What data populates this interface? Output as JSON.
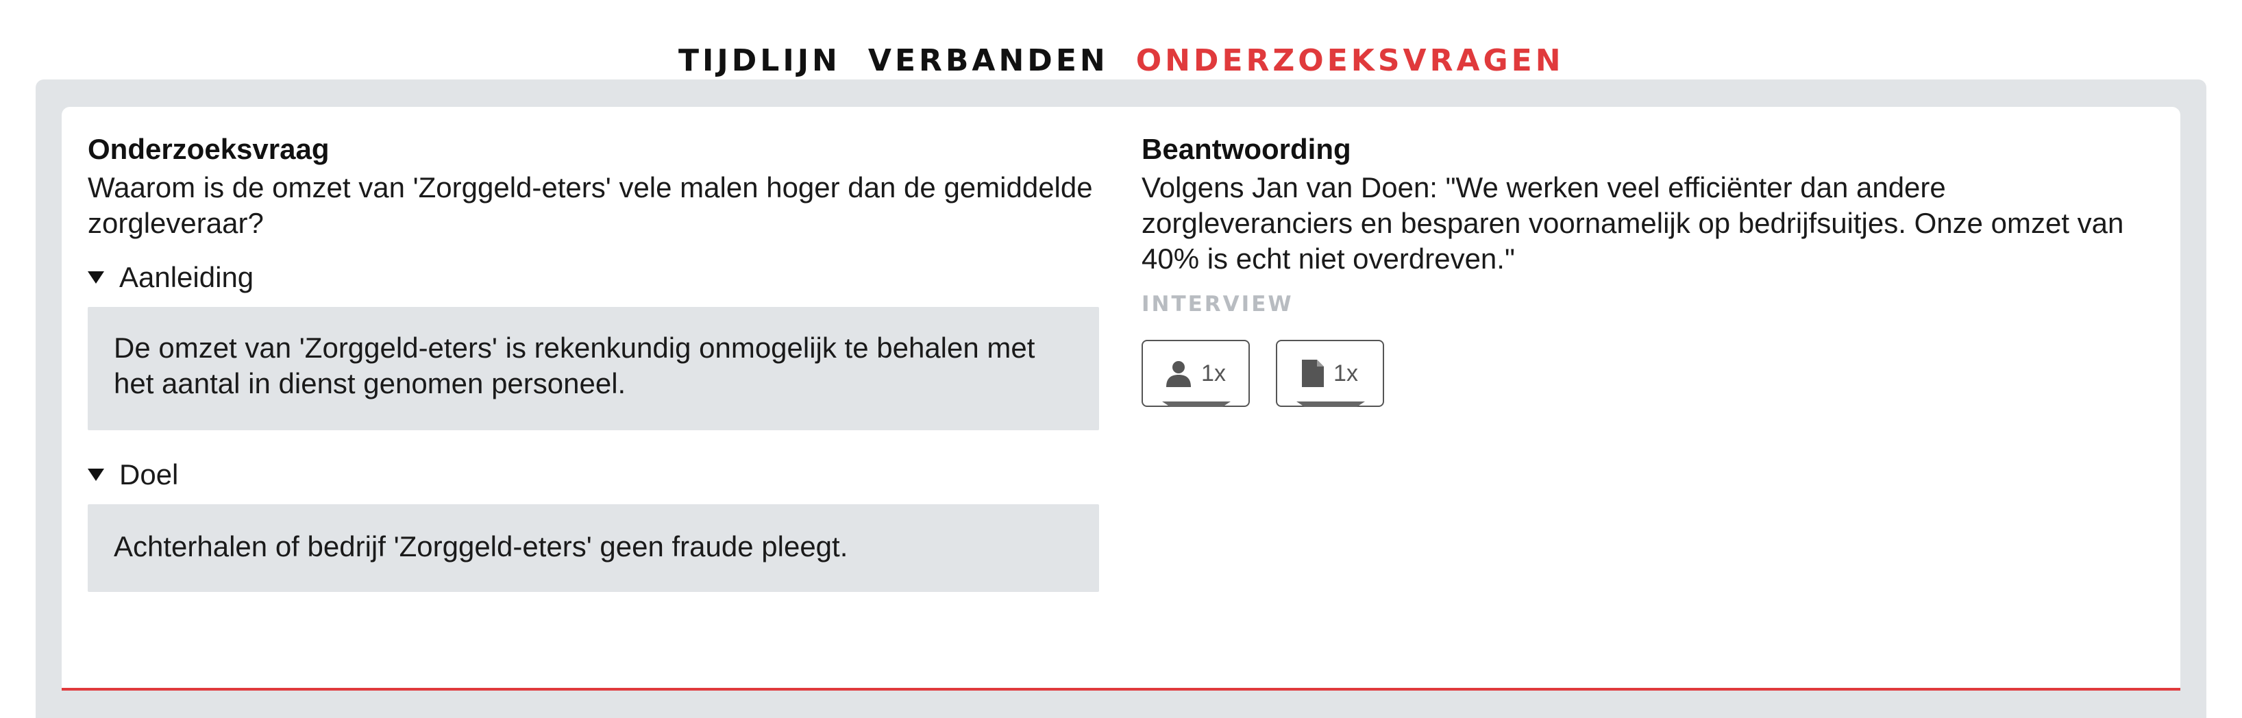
{
  "tabs": [
    {
      "label": "TIJDLIJN",
      "active": false
    },
    {
      "label": "VERBANDEN",
      "active": false
    },
    {
      "label": "ONDERZOEKSVRAGEN",
      "active": true
    }
  ],
  "question": {
    "heading": "Onderzoeksvraag",
    "text": "Waarom is de omzet van 'Zorggeld-eters' vele malen hoger dan de gemiddelde zorgleveraar?"
  },
  "sections": [
    {
      "label": "Aanleiding",
      "text": "De omzet van 'Zorggeld-eters' is rekenkundig onmogelijk te behalen met het aantal in dienst genomen personeel."
    },
    {
      "label": "Doel",
      "text": "Achterhalen of bedrijf 'Zorggeld-eters' geen fraude pleegt."
    }
  ],
  "answer": {
    "heading": "Beantwoording",
    "text": "Volgens Jan van Doen: \"We werken veel efficiënter dan andere zorgleveranciers en besparen voornamelijk op bedrijfsuitjes. Onze omzet van 40% is echt niet overdreven.\"",
    "source_label": "INTERVIEW"
  },
  "chips": [
    {
      "icon": "person-icon",
      "count": "1x"
    },
    {
      "icon": "document-icon",
      "count": "1x"
    }
  ],
  "colors": {
    "accent": "#e03a3c",
    "panel_bg": "#e1e4e7",
    "muted": "#b8bcc1"
  }
}
